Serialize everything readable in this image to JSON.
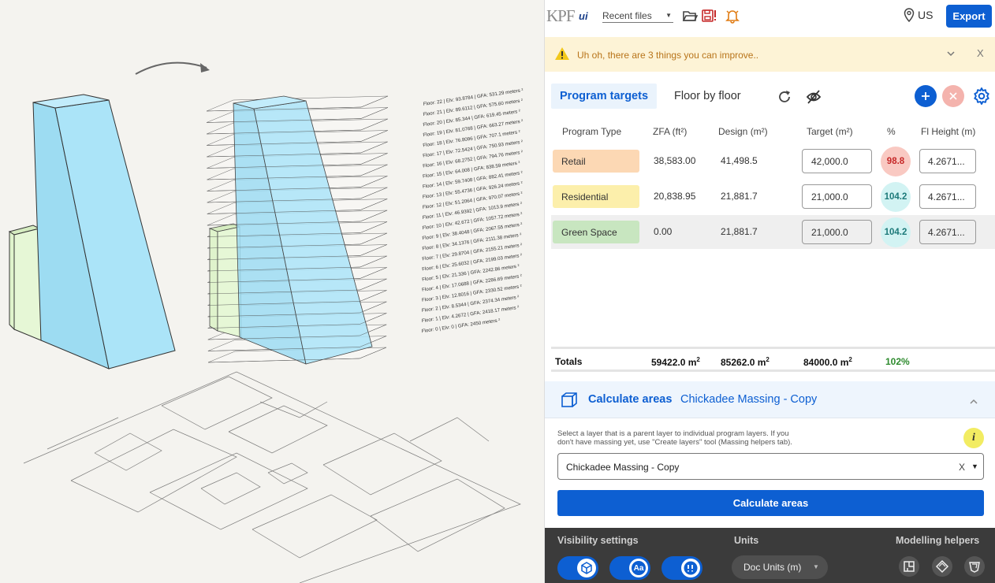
{
  "viewport": {
    "floor_labels": [
      "Floor: 22 | Elv: 93.8784 | GFA: 531.29 meters ²",
      "Floor: 21 | Elv: 89.6112 | GFA: 575.60 meters ²",
      "Floor: 20 | Elv: 85.344 | GFA: 619.45 meters ²",
      "Floor: 19 | Elv: 81.0768 | GFA: 663.27 meters ²",
      "Floor: 18 | Elv: 76.8096 | GFA: 707.1 meters ²",
      "Floor: 17 | Elv: 72.5424 | GFA: 750.93 meters ²",
      "Floor: 16 | Elv: 68.2752 | GFA: 794.76 meters ²",
      "Floor: 15 | Elv: 64.008 | GFA: 838.59 meters ²",
      "Floor: 14 | Elv: 59.7408 | GFA: 882.41 meters ²",
      "Floor: 13 | Elv: 55.4736 | GFA: 926.24 meters ²",
      "Floor: 12 | Elv: 51.2064 | GFA: 970.07 meters ²",
      "Floor: 11 | Elv: 46.9392 | GFA: 1013.9 meters ²",
      "Floor: 10 | Elv: 42.672 | GFA: 1057.72 meters ²",
      "Floor: 9 | Elv: 38.4048 | GFA: 2067.55 meters ²",
      "Floor: 8 | Elv: 34.1376 | GFA: 2111.38 meters ²",
      "Floor: 7 | Elv: 29.8704 | GFA: 2155.21 meters ²",
      "Floor: 6 | Elv: 25.6032 | GFA: 2199.03 meters ²",
      "Floor: 5 | Elv: 21.336 | GFA: 2242.86 meters ²",
      "Floor: 4 | Elv: 17.0688 | GFA: 2286.69 meters ²",
      "Floor: 3 | Elv: 12.8016 | GFA: 2330.52 meters ²",
      "Floor: 2 | Elv: 8.5344 | GFA: 2374.34 meters ²",
      "Floor: 1 | Elv: 4.2672 | GFA: 2418.17 meters ²",
      "Floor: 0 | Elv: 0 | GFA: 2450 meters ²"
    ]
  },
  "topbar": {
    "logo_main": "KPF",
    "logo_sub": "ui",
    "recent_files": "Recent files",
    "location": "US",
    "export_label": "Export"
  },
  "warning": {
    "message": "Uh oh, there are 3 things you can improve..",
    "close": "X"
  },
  "tabs": {
    "program_targets": "Program targets",
    "floor_by_floor": "Floor by floor"
  },
  "table": {
    "headers": {
      "program_type": "Program Type",
      "zfa": "ZFA (ft²)",
      "design": "Design (m²)",
      "target": "Target (m²)",
      "pct": "%",
      "fl_height": "Fl Height (m)"
    },
    "rows": [
      {
        "name": "Retail",
        "zfa": "38,583.00",
        "design": "41,498.5",
        "target": "42,000.0",
        "pct": "98.8",
        "height": "4.2671...",
        "color": "#fcd8b4"
      },
      {
        "name": "Residential",
        "zfa": "20,838.95",
        "design": "21,881.7",
        "target": "21,000.0",
        "pct": "104.2",
        "height": "4.2671...",
        "color": "#fcefab"
      },
      {
        "name": "Green Space",
        "zfa": "0.00",
        "design": "21,881.7",
        "target": "21,000.0",
        "pct": "104.2",
        "height": "4.2671...",
        "color": "#c8e6c0"
      }
    ],
    "totals": {
      "label": "Totals",
      "zfa": "59422.0 m",
      "design": "85262.0 m",
      "target": "84000.0 m",
      "unit_sup": "2",
      "pct": "102%"
    }
  },
  "calculate": {
    "title": "Calculate areas",
    "subtitle": "Chickadee Massing - Copy",
    "help_line1": "Select a layer that is a parent layer to individual program layers. If you",
    "help_line2": "don't have massing yet, use \"Create layers\" tool (Massing helpers tab).",
    "info": "i",
    "selected_layer": "Chickadee Massing - Copy",
    "clear": "X",
    "button_label": "Calculate areas"
  },
  "bottom": {
    "visibility_label": "Visibility settings",
    "units_label": "Units",
    "helpers_label": "Modelling helpers",
    "units_value": "Doc Units (m)",
    "toggle_aa": "Aa"
  },
  "colors": {
    "accent": "#0d5fd2",
    "warning_bg": "#fdf3d6",
    "warning_text": "#b8741a",
    "badge_low": "#f9c9c2",
    "badge_high": "#d2f3f3",
    "massing_blue": "#a8e3f7",
    "massing_green": "#e1f5d0"
  }
}
